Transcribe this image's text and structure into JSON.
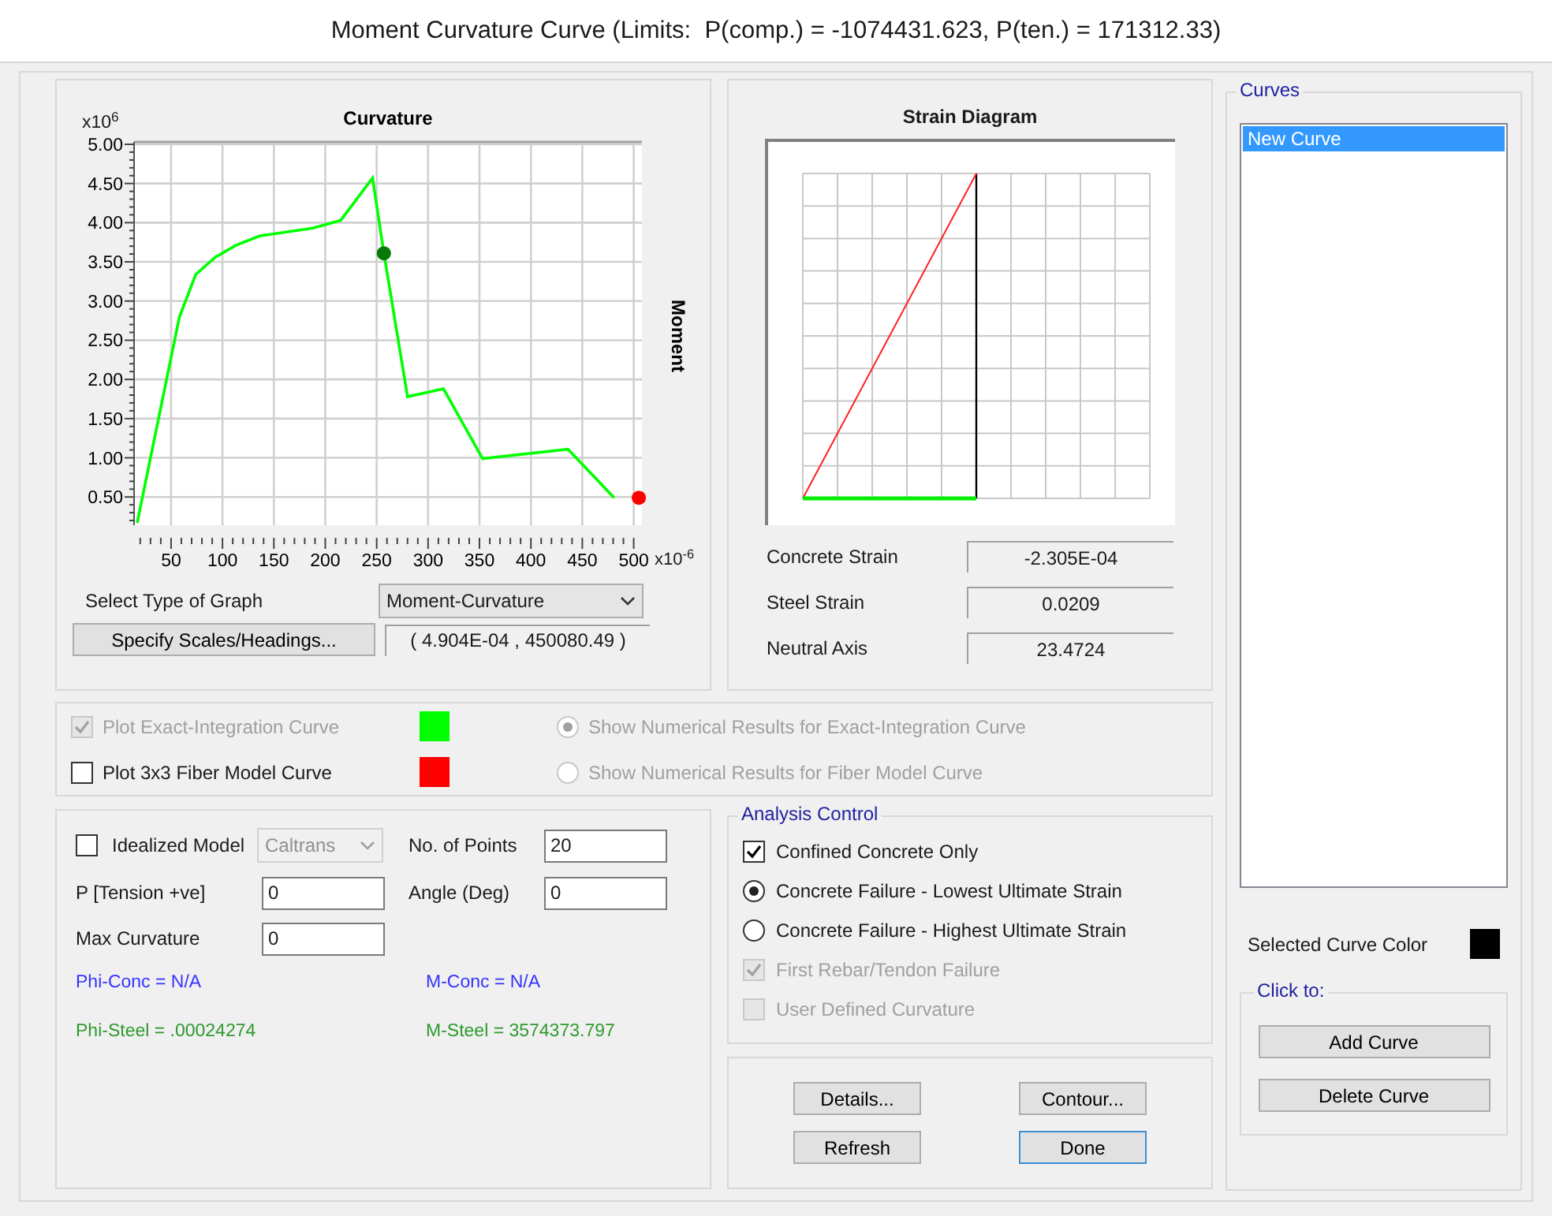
{
  "window": {
    "title": "Moment Curvature Curve (Limits:  P(comp.) = -1074431.623, P(ten.) = 171312.33)"
  },
  "curvature_plot": {
    "y_scale": "x10$^{6}$",
    "x_scale": "x10$^{-6}$",
    "chart_data": {
      "type": "line",
      "title": "Curvature",
      "ylabel": "Moment",
      "grid": true,
      "xlim": [
        14,
        508
      ],
      "ylim": [
        0.14,
        5.03
      ],
      "xticks": [
        50,
        100,
        150,
        200,
        250,
        300,
        350,
        400,
        450,
        500
      ],
      "yticks": [
        {
          "value": 0.5,
          "label": "0.50"
        },
        {
          "value": 1,
          "label": "1.00"
        },
        {
          "value": 1.5,
          "label": "1.50"
        },
        {
          "value": 2,
          "label": "2.00"
        },
        {
          "value": 2.5,
          "label": "2.50"
        },
        {
          "value": 3,
          "label": "3.00"
        },
        {
          "value": 3.5,
          "label": "3.50"
        },
        {
          "value": 4,
          "label": "4.00"
        },
        {
          "value": 4.5,
          "label": "4.50"
        },
        {
          "value": 5,
          "label": "5.00"
        }
      ],
      "x": [
        17,
        58,
        74,
        93,
        113,
        136,
        162,
        188,
        215,
        246,
        257,
        280,
        315,
        353,
        436,
        481,
        505
      ],
      "series": [
        {
          "color": "#00ff00",
          "values": [
            0.17,
            2.79,
            3.34,
            3.56,
            3.71,
            3.83,
            3.88,
            3.93,
            4.03,
            4.57,
            3.61,
            1.78,
            1.88,
            0.99,
            1.11,
            0.49,
            null
          ]
        },
        {
          "color": "#067a06",
          "marker": "circle",
          "values": [
            null,
            null,
            null,
            null,
            null,
            null,
            null,
            null,
            null,
            null,
            3.61,
            null,
            null,
            null,
            null,
            null,
            null
          ]
        },
        {
          "color": "#ff0000",
          "marker": "circle",
          "values": [
            null,
            null,
            null,
            null,
            null,
            null,
            null,
            null,
            null,
            null,
            null,
            null,
            null,
            null,
            null,
            null,
            0.49
          ]
        }
      ]
    },
    "graph_type": {
      "label": "Select Type of Graph",
      "value": "Moment-Curvature"
    },
    "scales_button": "Specify Scales/Headings...",
    "readout": "( 4.904E-04 , 450080.49 )"
  },
  "strain_diagram": {
    "title": "Strain Diagram",
    "readings": [
      {
        "label": "Concrete Strain",
        "value": "-2.305E-04"
      },
      {
        "label": "Steel Strain",
        "value": "0.0209"
      },
      {
        "label": "Neutral Axis",
        "value": "23.4724"
      }
    ]
  },
  "plot_options": [
    {
      "label": "Plot Exact-Integration Curve",
      "checked": true,
      "disabled": true,
      "color": "#00ff00",
      "radio_label": "Show Numerical Results for Exact-Integration Curve",
      "radio_selected": true
    },
    {
      "label": "Plot 3x3 Fiber Model Curve",
      "checked": false,
      "disabled": false,
      "color": "#ff0000",
      "radio_label": "Show Numerical Results for Fiber Model Curve",
      "radio_selected": false
    }
  ],
  "parameters": {
    "idealized": {
      "label": "Idealized Model",
      "checked": false,
      "model": "Caltrans"
    },
    "fields": [
      {
        "label": "No. of Points",
        "value": "20"
      },
      {
        "label": "P [Tension +ve]",
        "value": "0"
      },
      {
        "label": "Angle (Deg)",
        "value": "0"
      },
      {
        "label": "Max Curvature",
        "value": "0"
      }
    ],
    "results": [
      {
        "text": "Phi-Conc = N/A",
        "color": "#3333ff"
      },
      {
        "text": "M-Conc = N/A",
        "color": "#3333ff"
      },
      {
        "text": "Phi-Steel = .00024274",
        "color": "#2e9a2e"
      },
      {
        "text": "M-Steel = 3574373.797",
        "color": "#2e9a2e"
      }
    ]
  },
  "analysis_control": {
    "title": "Analysis Control",
    "options": [
      {
        "kind": "checkbox",
        "label": "Confined Concrete Only",
        "checked": true,
        "disabled": false
      },
      {
        "kind": "radio",
        "label": "Concrete Failure - Lowest Ultimate Strain",
        "selected": true,
        "disabled": false
      },
      {
        "kind": "radio",
        "label": "Concrete Failure - Highest Ultimate Strain",
        "selected": false,
        "disabled": false
      },
      {
        "kind": "checkbox",
        "label": "First Rebar/Tendon Failure",
        "checked": true,
        "disabled": true
      },
      {
        "kind": "checkbox",
        "label": "User Defined Curvature",
        "checked": false,
        "disabled": true
      }
    ]
  },
  "buttons": [
    {
      "label": "Details...",
      "focused": false
    },
    {
      "label": "Contour...",
      "focused": false
    },
    {
      "label": "Refresh",
      "focused": false
    },
    {
      "label": "Done",
      "focused": true
    }
  ],
  "curves": {
    "title": "Curves",
    "items": [
      {
        "label": "New Curve",
        "selected": true
      }
    ],
    "color_label": "Selected Curve Color",
    "color": "#000000",
    "click_title": "Click to:",
    "buttons": [
      "Add Curve",
      "Delete Curve"
    ]
  }
}
